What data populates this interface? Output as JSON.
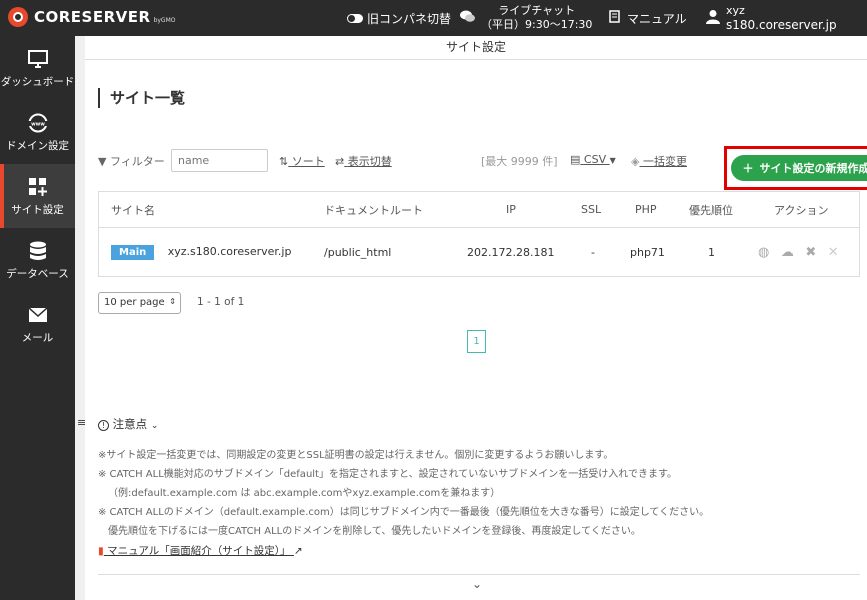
{
  "header": {
    "logo_text": "CORESERVER",
    "logo_sub": "byGMO",
    "toggle_label": "旧コンパネ切替",
    "chat_line1": "ライブチャット",
    "chat_line2": "（平日）9:30〜17:30",
    "manual_label": "マニュアル",
    "user_name": "xyz",
    "user_server": "s180.coreserver.jp"
  },
  "sidebar": {
    "items": [
      {
        "label": "ダッシュボード",
        "icon": "monitor-icon"
      },
      {
        "label": "ドメイン設定",
        "icon": "globe-www-icon"
      },
      {
        "label": "サイト設定",
        "icon": "grid-plus-icon"
      },
      {
        "label": "データベース",
        "icon": "database-icon"
      },
      {
        "label": "メール",
        "icon": "envelope-icon"
      }
    ]
  },
  "page": {
    "breadcrumb": "サイト設定",
    "title": "サイト一覧"
  },
  "toolbar": {
    "filter_label": "フィルター",
    "filter_placeholder": "name",
    "sort_label": "ソート",
    "display_toggle": "表示切替",
    "max_count": "[最大 9999 件]",
    "csv_label": "CSV",
    "bulk_edit": "一括変更",
    "new_button": "サイト設定の新規作成"
  },
  "table": {
    "headers": [
      "サイト名",
      "ドキュメントルート",
      "IP",
      "SSL",
      "PHP",
      "優先順位",
      "アクション"
    ],
    "rows": [
      {
        "badge": "Main",
        "site": "xyz.s180.coreserver.jp",
        "docroot": "/public_html",
        "ip": "202.172.28.181",
        "ssl": "-",
        "php": "php71",
        "priority": "1"
      }
    ]
  },
  "pagination": {
    "per_page": "10 per page",
    "range": "1 - 1 of 1",
    "current_page": "1"
  },
  "notes": {
    "title": "注意点",
    "lines": [
      "※サイト設定一括変更では、同期設定の変更とSSL証明書の設定は行えません。個別に変更するようお願いします。",
      "※ CATCH ALL機能対応のサブドメイン「default」を指定されますと、設定されていないサブドメインを一括受け入れできます。",
      "（例:default.example.com は abc.example.comやxyz.example.comを兼ねます）",
      "※ CATCH ALLのドメイン（default.example.com）は同じサブドメイン内で一番最後（優先順位を大きな番号）に設定してください。",
      "優先順位を下げるには一度CATCH ALLのドメインを削除して、優先したいドメインを登録後、再度設定してください。"
    ],
    "manual_link": "マニュアル「画面紹介（サイト設定）」"
  },
  "colors": {
    "header_bg": "#2b2b2b",
    "accent": "#e8492c",
    "primary_button": "#2ca24c",
    "highlight_border": "#e30000",
    "badge": "#4aa3df",
    "pager": "#45b8b0"
  }
}
